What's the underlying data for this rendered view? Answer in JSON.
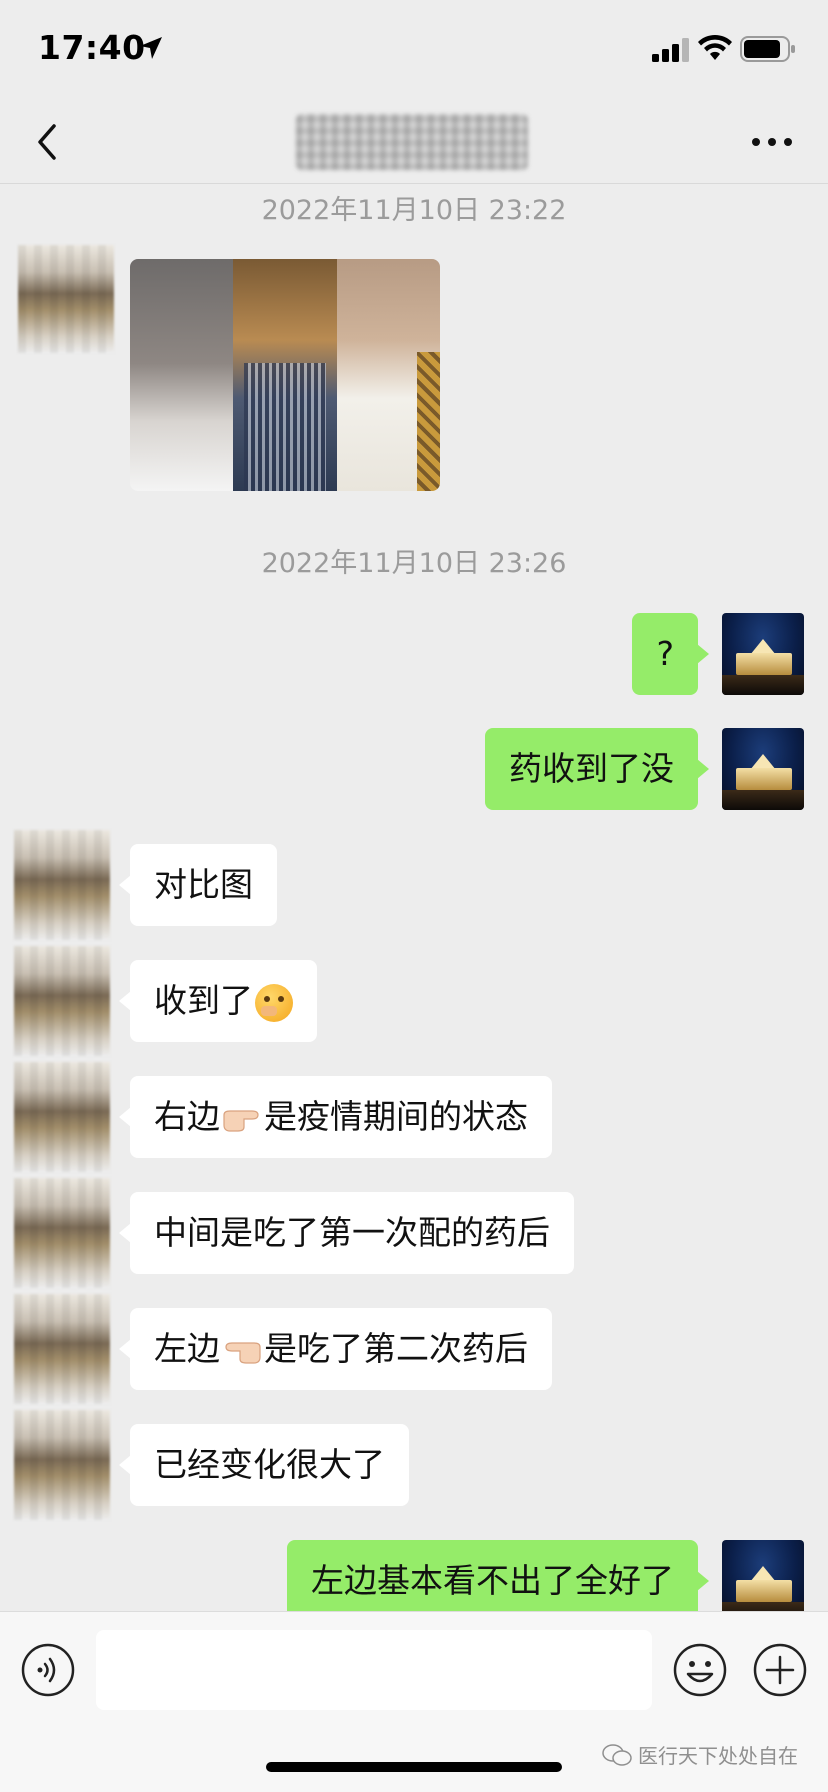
{
  "status_bar": {
    "time": "17:40",
    "icons": [
      "location-arrow-icon",
      "signal-icon",
      "wifi-icon",
      "battery-icon"
    ]
  },
  "nav": {
    "back_icon": "chevron-left-icon",
    "more_icon": "more-dots-icon"
  },
  "messages": [
    {
      "type": "timestamp",
      "text": "2022年11月10日 23:22"
    },
    {
      "type": "image",
      "from": "contact",
      "description_icons": [
        "photo-left",
        "photo-middle",
        "photo-right"
      ]
    },
    {
      "type": "timestamp",
      "text": "2022年11月10日 23:26"
    },
    {
      "type": "text",
      "from": "me",
      "text": "?"
    },
    {
      "type": "text",
      "from": "me",
      "text": "药收到了没"
    },
    {
      "type": "text",
      "from": "contact",
      "text": "对比图"
    },
    {
      "type": "text",
      "from": "contact",
      "text": "收到了",
      "emoji": "thinking-face-emoji"
    },
    {
      "type": "text",
      "from": "contact",
      "text_before": "右边",
      "emoji": "pointing-right-emoji",
      "text_after": "是疫情期间的状态"
    },
    {
      "type": "text",
      "from": "contact",
      "text": "中间是吃了第一次配的药后"
    },
    {
      "type": "text",
      "from": "contact",
      "text_before": "左边",
      "emoji": "pointing-left-emoji",
      "text_after": "是吃了第二次药后"
    },
    {
      "type": "text",
      "from": "contact",
      "text": "已经变化很大了"
    },
    {
      "type": "text",
      "from": "me",
      "text": "左边基本看不出了全好了"
    }
  ],
  "input_bar": {
    "voice_icon": "voice-icon",
    "text_value": "",
    "emoji_icon": "emoji-icon",
    "plus_icon": "plus-icon"
  },
  "watermark": {
    "text": "医行天下处处自在",
    "icon": "wechat-icon"
  },
  "colors": {
    "background": "#ededed",
    "sent_bubble": "#95ec69",
    "received_bubble": "#ffffff",
    "timestamp_text": "#9b9b9b"
  }
}
